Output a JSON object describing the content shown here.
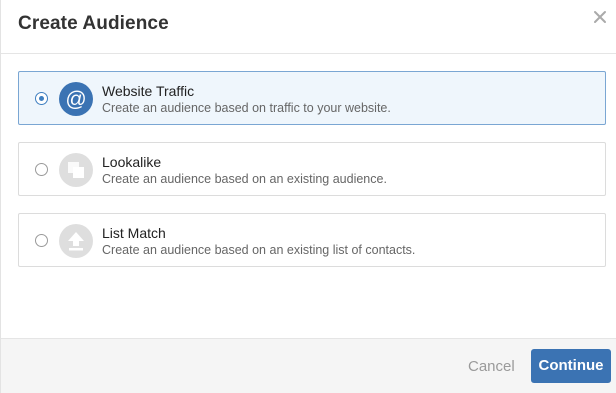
{
  "dialog": {
    "title": "Create Audience",
    "close_icon": "close-icon"
  },
  "options": [
    {
      "title": "Website Traffic",
      "description": "Create an audience based on traffic to your website.",
      "icon": "at-sign-icon",
      "selected": true
    },
    {
      "title": "Lookalike",
      "description": "Create an audience based on an existing audience.",
      "icon": "lookalike-squares-icon",
      "selected": false
    },
    {
      "title": "List Match",
      "description": "Create an audience based on an existing list of contacts.",
      "icon": "upload-icon",
      "selected": false
    }
  ],
  "footer": {
    "cancel_label": "Cancel",
    "continue_label": "Continue"
  },
  "colors": {
    "accent": "#3b73b3",
    "selected_bg": "#eff6fc",
    "footer_bg": "#f5f5f5"
  }
}
